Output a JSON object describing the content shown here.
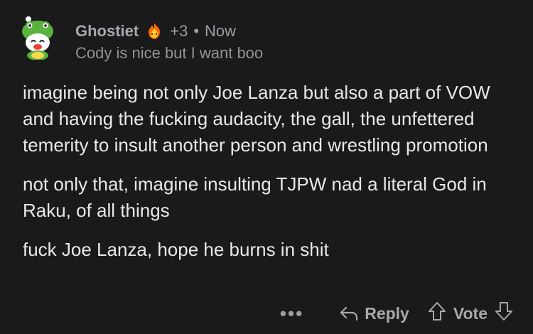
{
  "comment": {
    "username": "Ghostiet",
    "score": "+3",
    "separator": "•",
    "time": "Now",
    "flair": "Cody is nice but I want boo",
    "paragraphs": [
      "imagine being not only Joe Lanza but also a part of VOW and having the fucking audacity, the gall, the unfettered temerity to insult another person and wrestling promotion",
      "not only that, imagine insulting TJPW nad a literal God in Raku, of all things",
      "fuck Joe Lanza, hope he burns in shit"
    ]
  },
  "actions": {
    "more": "•••",
    "reply_label": "Reply",
    "vote_label": "Vote"
  },
  "icons": {
    "avatar": "snoo-frog-hat-avatar",
    "flair": "flame-award-icon",
    "reply": "reply-arrow-icon",
    "upvote": "upvote-arrow-icon",
    "downvote": "downvote-arrow-icon"
  }
}
